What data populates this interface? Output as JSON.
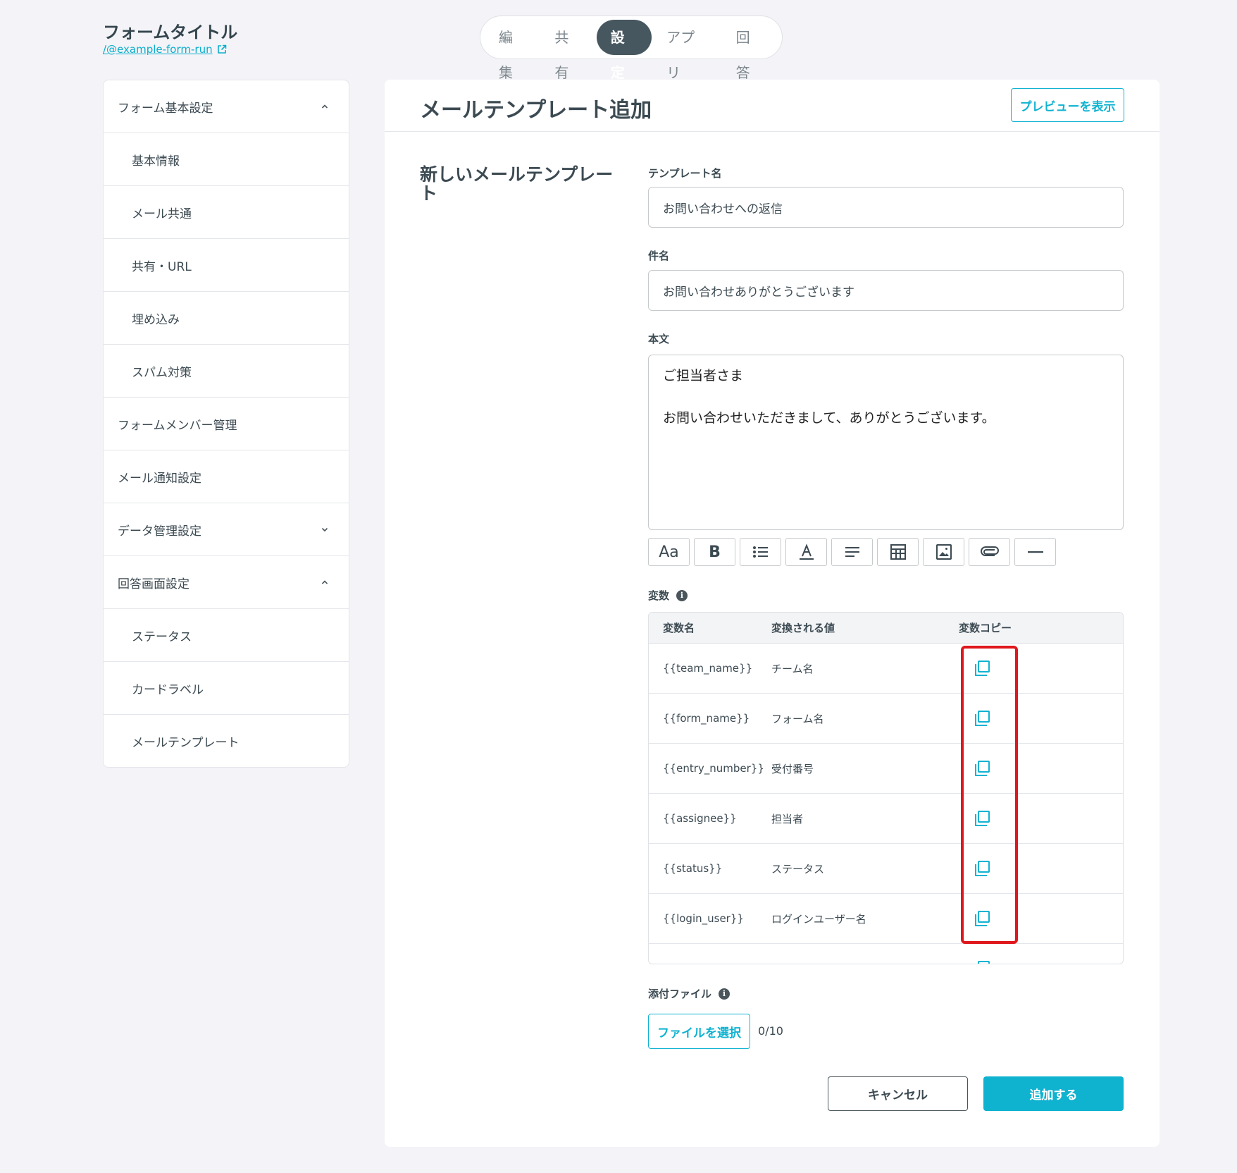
{
  "header": {
    "form_title": "フォームタイトル",
    "form_link": "/@example-form-run",
    "tabs": [
      {
        "label": "編集"
      },
      {
        "label": "共有"
      },
      {
        "label": "設定"
      },
      {
        "label": "アプリ"
      },
      {
        "label": "回答"
      }
    ],
    "active_tab": "設定"
  },
  "sidebar": {
    "items": [
      {
        "label": "フォーム基本設定"
      },
      {
        "label": "基本情報"
      },
      {
        "label": "メール共通"
      },
      {
        "label": "共有・URL"
      },
      {
        "label": "埋め込み"
      },
      {
        "label": "スパム対策"
      },
      {
        "label": "フォームメンバー管理"
      },
      {
        "label": "メール通知設定"
      },
      {
        "label": "データ管理設定"
      },
      {
        "label": "回答画面設定"
      },
      {
        "label": "ステータス"
      },
      {
        "label": "カードラベル"
      },
      {
        "label": "メールテンプレート"
      }
    ]
  },
  "main": {
    "title": "メールテンプレート追加",
    "preview_label": "プレビューを表示",
    "section_title_line1": "新しいメールテンプレー",
    "section_title_line2": "ト",
    "template_name_label": "テンプレート名",
    "template_name_value": "お問い合わせへの返信",
    "subject_label": "件名",
    "subject_value": "お問い合わせありがとうございます",
    "body_label": "本文",
    "body_line1": "ご担当者さま",
    "body_line2": "お問い合わせいただきまして、ありがとうございます。",
    "toolbar": {
      "font_label": "Aa",
      "bold_label": "B"
    },
    "variables": {
      "label": "変数",
      "headers": {
        "name": "変数名",
        "value": "変換される値",
        "copy": "変数コピー"
      },
      "rows": [
        {
          "name": "{{team_name}}",
          "value": "チーム名"
        },
        {
          "name": "{{form_name}}",
          "value": "フォーム名"
        },
        {
          "name": "{{entry_number}}",
          "value": "受付番号"
        },
        {
          "name": "{{assignee}}",
          "value": "担当者"
        },
        {
          "name": "{{status}}",
          "value": "ステータス"
        },
        {
          "name": "{{login_user}}",
          "value": "ログインユーザー名"
        }
      ]
    },
    "attachment": {
      "label": "添付ファイル",
      "button": "ファイルを選択",
      "count": "0/10"
    },
    "cancel_label": "キャンセル",
    "submit_label": "追加する"
  },
  "colors": {
    "accent": "#0fb2cf",
    "active_tab_bg": "#475760",
    "highlight": "#e0171c",
    "background": "#f4f4f8"
  },
  "icons": [
    "external-link-icon",
    "chevron-up-icon",
    "chevron-down-icon",
    "info-icon",
    "font-size-icon",
    "bold-icon",
    "list-icon",
    "text-color-icon",
    "align-icon",
    "table-icon",
    "image-icon",
    "attachment-icon",
    "horizontal-rule-icon",
    "copy-icon"
  ]
}
